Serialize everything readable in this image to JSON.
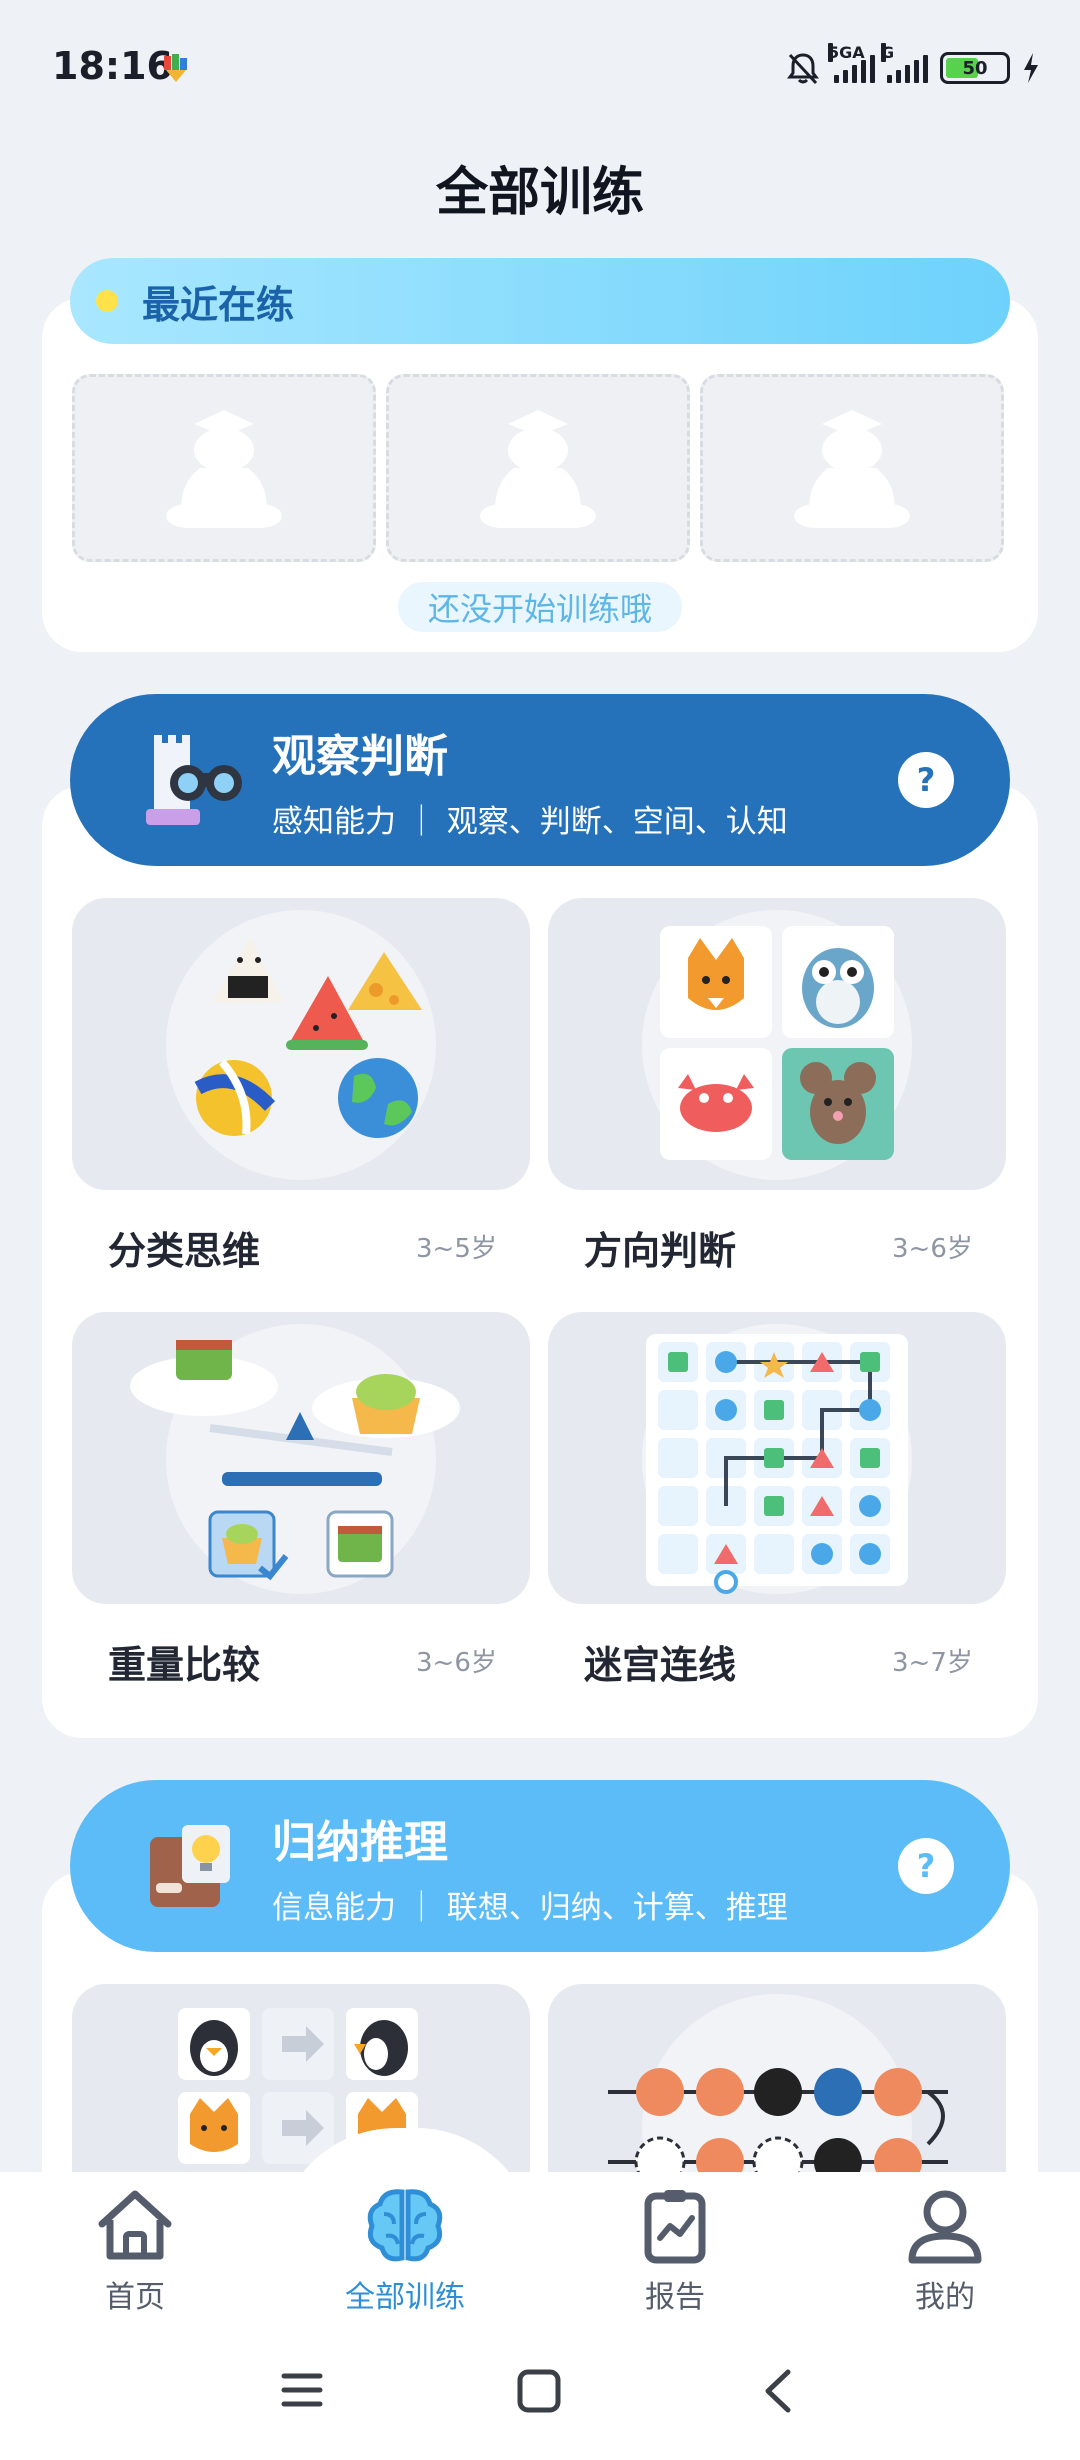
{
  "status_bar": {
    "time": "18:16",
    "network_1": "5GA",
    "network_2": "G",
    "battery": "50"
  },
  "page_title": "全部训练",
  "recent": {
    "title": "最近在练",
    "empty_hint": "还没开始训练哦"
  },
  "categories": [
    {
      "title": "观察判断",
      "subtitle": "感知能力 ｜  观察、判断、空间、认知",
      "help": "?",
      "color": "#2571ba",
      "games": [
        {
          "name": "分类思维",
          "age": "3~5岁"
        },
        {
          "name": "方向判断",
          "age": "3~6岁"
        },
        {
          "name": "重量比较",
          "age": "3~6岁"
        },
        {
          "name": "迷宫连线",
          "age": "3~7岁"
        }
      ]
    },
    {
      "title": "归纳推理",
      "subtitle": "信息能力 ｜  联想、归纳、计算、推理",
      "help": "?",
      "color": "#5bbcf8",
      "games": []
    }
  ],
  "bottom_nav": [
    {
      "label": "首页",
      "icon": "home-icon"
    },
    {
      "label": "全部训练",
      "icon": "brain-icon",
      "active": true
    },
    {
      "label": "报告",
      "icon": "report-icon"
    },
    {
      "label": "我的",
      "icon": "profile-icon"
    }
  ]
}
